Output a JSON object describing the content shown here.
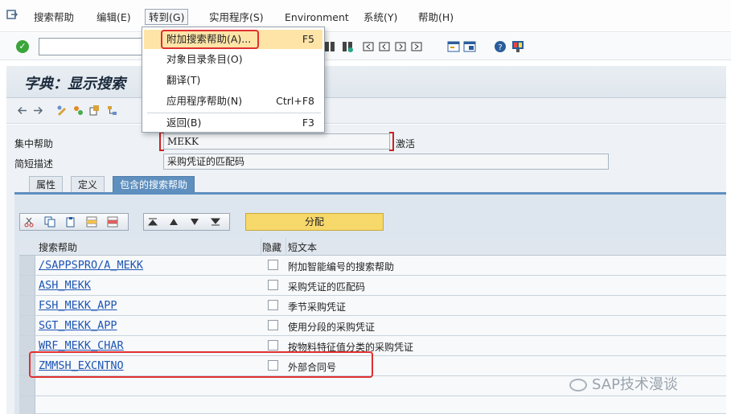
{
  "menubar": {
    "items": [
      "搜索帮助",
      "编辑(E)",
      "转到(G)",
      "实用程序(S)",
      "Environment",
      "系统(Y)",
      "帮助(H)"
    ]
  },
  "dropdown": {
    "items": [
      {
        "label": "附加搜索帮助(A)...",
        "key": "F5"
      },
      {
        "label": "对象目录条目(O)",
        "key": ""
      },
      {
        "label": "翻译(T)",
        "key": ""
      },
      {
        "label": "应用程序帮助(N)",
        "key": "Ctrl+F8"
      },
      {
        "label": "返回(B)",
        "key": "F3"
      }
    ]
  },
  "title": "字典：显示搜索",
  "fields": {
    "collective_label": "集中帮助",
    "collective_value": "MEKK",
    "status": "激活",
    "short_desc_label": "简短描述",
    "short_desc_value": "采购凭证的匹配码"
  },
  "tabs": [
    "属性",
    "定义",
    "包含的搜索帮助"
  ],
  "assign_button": "分配",
  "table": {
    "headers": [
      "搜索帮助",
      "隐藏",
      "短文本"
    ],
    "rows": [
      {
        "name": "/SAPPSPRO/A_MEKK",
        "desc": "附加智能编号的搜索帮助"
      },
      {
        "name": "ASH_MEKK",
        "desc": "采购凭证的匹配码"
      },
      {
        "name": "FSH_MEKK_APP",
        "desc": "季节采购凭证"
      },
      {
        "name": "SGT_MEKK_APP",
        "desc": "使用分段的采购凭证"
      },
      {
        "name": "WRF_MEKK_CHAR",
        "desc": "按物料特征值分类的采购凭证"
      },
      {
        "name": "ZMMSH_EXCNTNO",
        "desc": "外部合同号"
      }
    ]
  },
  "watermark": "SAP技术漫谈",
  "colors": {
    "accent": "#5e8fbf",
    "highlight": "#ffe4a8",
    "annotation": "#e03030"
  }
}
